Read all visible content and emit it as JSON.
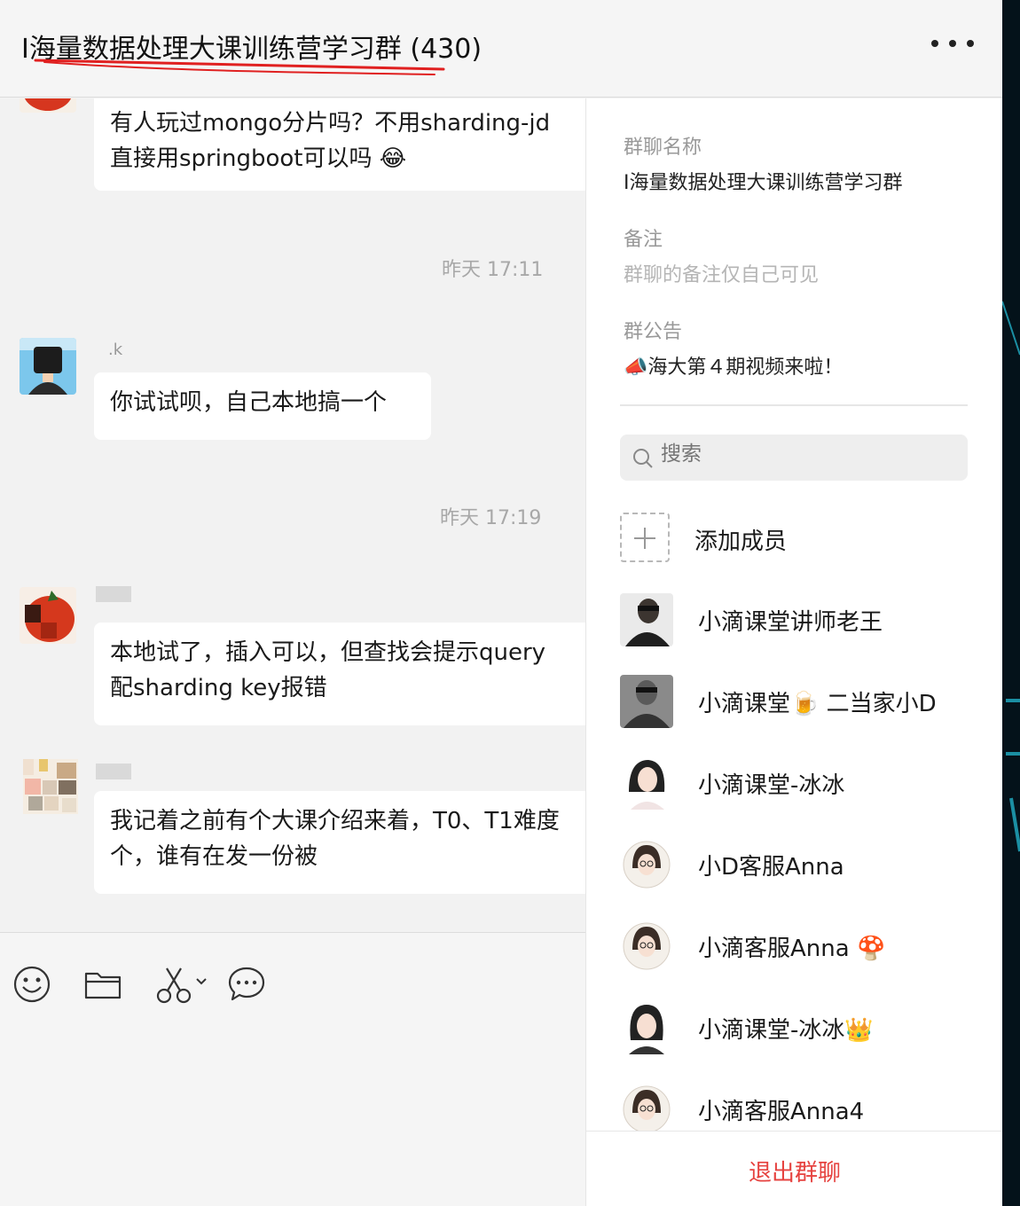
{
  "header": {
    "title": "I海量数据处理大课训练营学习群 (430)",
    "more_icon": "more-horizontal-icon"
  },
  "chat": {
    "messages": [
      {
        "sender": "",
        "lines": [
          "有人玩过mongo分片吗？不用sharding-jd",
          "直接用springboot可以吗"
        ],
        "emoji": "😂"
      },
      {
        "sender": ".k",
        "lines": [
          "你试试呗，自己本地搞一个"
        ]
      },
      {
        "sender": "",
        "lines": [
          "本地试了，插入可以，但查找会提示query",
          "配sharding key报错"
        ]
      },
      {
        "sender": "",
        "lines": [
          "我记着之前有个大课介绍来着，T0、T1难度",
          "个，谁有在发一份被"
        ]
      }
    ],
    "times": [
      "昨天 17:11",
      "昨天 17:19"
    ]
  },
  "toolbar": {
    "icons": [
      "emoji-icon",
      "folder-icon",
      "scissors-icon",
      "chat-bubble-icon"
    ]
  },
  "panel": {
    "group_name_label": "群聊名称",
    "group_name": "I海量数据处理大课训练营学习群",
    "remark_label": "备注",
    "remark_placeholder": "群聊的备注仅自己可见",
    "notice_label": "群公告",
    "notice": "📣海大第４期视频来啦！",
    "search_placeholder": "搜索",
    "add_member_label": "添加成员",
    "members": [
      {
        "name": "小滴课堂讲师老王"
      },
      {
        "name": "小滴课堂🍺 二当家小D"
      },
      {
        "name": "小滴课堂-冰冰"
      },
      {
        "name": "小D客服Anna"
      },
      {
        "name": "小滴客服Anna 🍄"
      },
      {
        "name": "小滴课堂-冰冰👑"
      },
      {
        "name": "小滴客服Anna4"
      }
    ],
    "leave_label": "退出群聊"
  },
  "colors": {
    "accent_red": "#e64340",
    "underline_red": "#e02020",
    "bubble": "#ffffff",
    "background": "#f2f2f2"
  }
}
